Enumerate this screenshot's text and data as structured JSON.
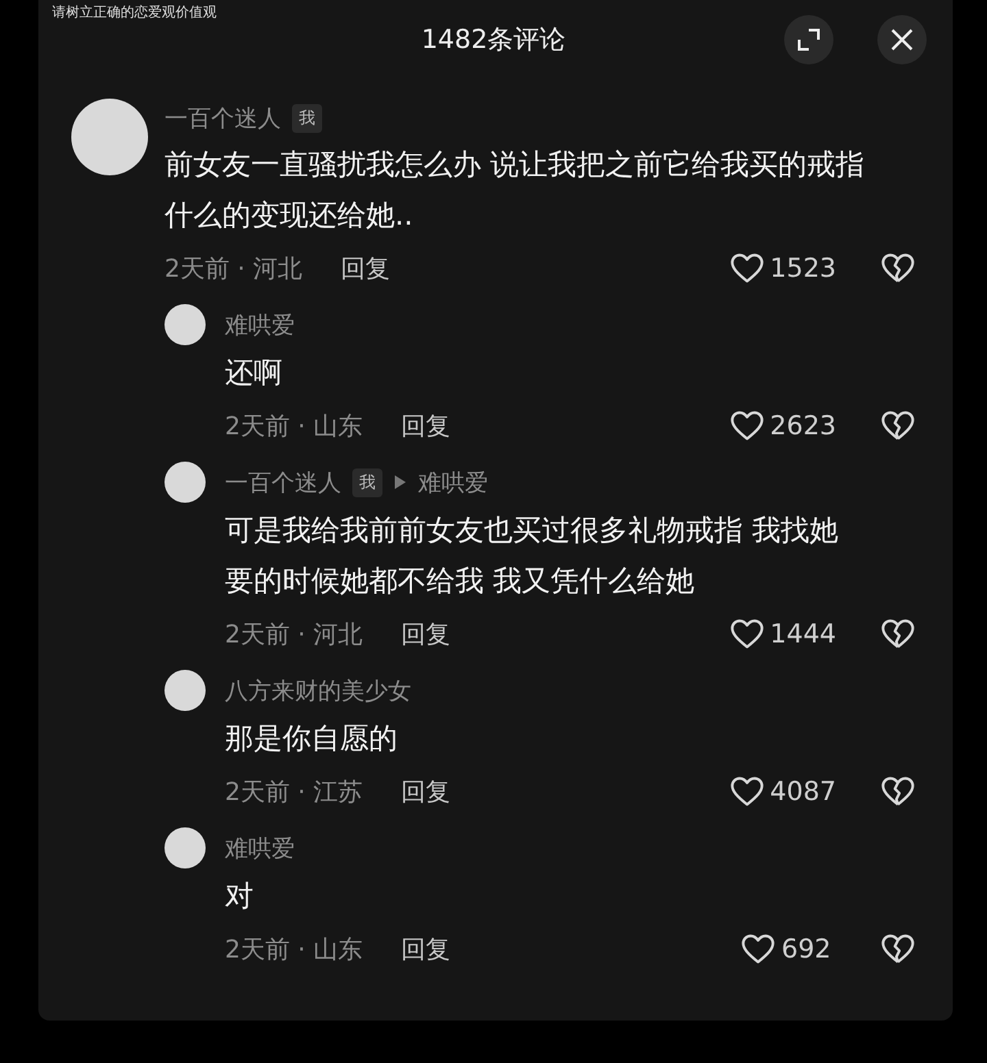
{
  "notice": "请树立正确的恋爱观价值观",
  "header": {
    "title": "1482条评论"
  },
  "comments": [
    {
      "author": "一百个迷人",
      "tag": "我",
      "text": "前女友一直骚扰我怎么办 说让我把之前它给我买的戒指什么的变现还给她..",
      "time_location": "2天前 · 河北",
      "reply_label": "回复",
      "likes": "1523",
      "replies": [
        {
          "author": "难哄爱",
          "text": "还啊",
          "time_location": "2天前 · 山东",
          "reply_label": "回复",
          "likes": "2623"
        },
        {
          "author": "一百个迷人",
          "tag": "我",
          "reply_to": "难哄爱",
          "text": "可是我给我前前女友也买过很多礼物戒指 我找她要的时候她都不给我 我又凭什么给她",
          "time_location": "2天前 · 河北",
          "reply_label": "回复",
          "likes": "1444"
        },
        {
          "author": "八方来财的美少女",
          "text": "那是你自愿的",
          "time_location": "2天前 · 江苏",
          "reply_label": "回复",
          "likes": "4087"
        },
        {
          "author": "难哄爱",
          "text": "对",
          "time_location": "2天前 · 山东",
          "reply_label": "回复",
          "likes": "692"
        }
      ]
    }
  ]
}
